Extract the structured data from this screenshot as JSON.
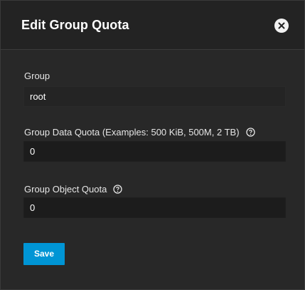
{
  "dialog": {
    "title": "Edit Group Quota",
    "close_icon": "close-icon"
  },
  "form": {
    "group": {
      "label": "Group",
      "value": "root"
    },
    "data_quota": {
      "label": "Group Data Quota (Examples: 500 KiB, 500M, 2 TB)",
      "value": "0",
      "help_icon": "help-circle-icon"
    },
    "object_quota": {
      "label": "Group Object Quota",
      "value": "0",
      "help_icon": "help-circle-icon"
    },
    "save_label": "Save"
  },
  "colors": {
    "accent": "#0095d5",
    "background": "#282828",
    "header": "#232323",
    "input": "#1c1c1c"
  }
}
